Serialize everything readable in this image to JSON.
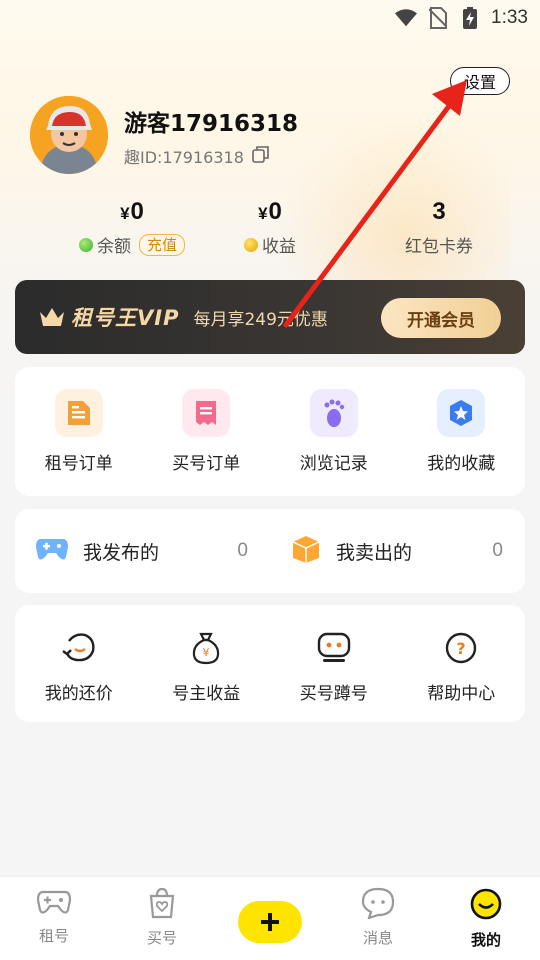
{
  "status_bar": {
    "time": "1:33"
  },
  "header": {
    "settings_label": "设置"
  },
  "profile": {
    "username": "游客17916318",
    "user_id": "趣ID:17916318"
  },
  "stats": {
    "balance": {
      "currency": "¥",
      "value": "0",
      "label": "余额",
      "recharge_label": "充值"
    },
    "earnings": {
      "currency": "¥",
      "value": "0",
      "label": "收益"
    },
    "coupons": {
      "value": "3",
      "label": "红包卡券"
    }
  },
  "vip": {
    "brand": "租号王VIP",
    "offer": "每月享249元优惠",
    "button": "开通会员"
  },
  "orders": [
    {
      "label": "租号订单",
      "icon": "document-icon",
      "color": "#f3a03a"
    },
    {
      "label": "买号订单",
      "icon": "receipt-icon",
      "color": "#f36b8c"
    },
    {
      "label": "浏览记录",
      "icon": "footprint-icon",
      "color": "#8a6cf0"
    },
    {
      "label": "我的收藏",
      "icon": "star-icon",
      "color": "#3a7cf0"
    }
  ],
  "published": [
    {
      "label": "我发布的",
      "count": "0",
      "icon": "gamepad-icon"
    },
    {
      "label": "我卖出的",
      "count": "0",
      "icon": "box-icon"
    }
  ],
  "tools": [
    {
      "label": "我的还价",
      "icon": "bargain-icon"
    },
    {
      "label": "号主收益",
      "icon": "money-bag-icon"
    },
    {
      "label": "买号蹲号",
      "icon": "robot-icon"
    },
    {
      "label": "帮助中心",
      "icon": "help-icon"
    }
  ],
  "nav": [
    {
      "label": "租号",
      "icon": "gamepad-icon"
    },
    {
      "label": "买号",
      "icon": "shopping-bag-icon"
    },
    {
      "label": "",
      "icon": "plus-icon"
    },
    {
      "label": "消息",
      "icon": "message-icon"
    },
    {
      "label": "我的",
      "icon": "profile-face-icon",
      "active": true
    }
  ],
  "colors": {
    "accent": "#ffe400",
    "annotation_arrow": "#e8231a"
  }
}
